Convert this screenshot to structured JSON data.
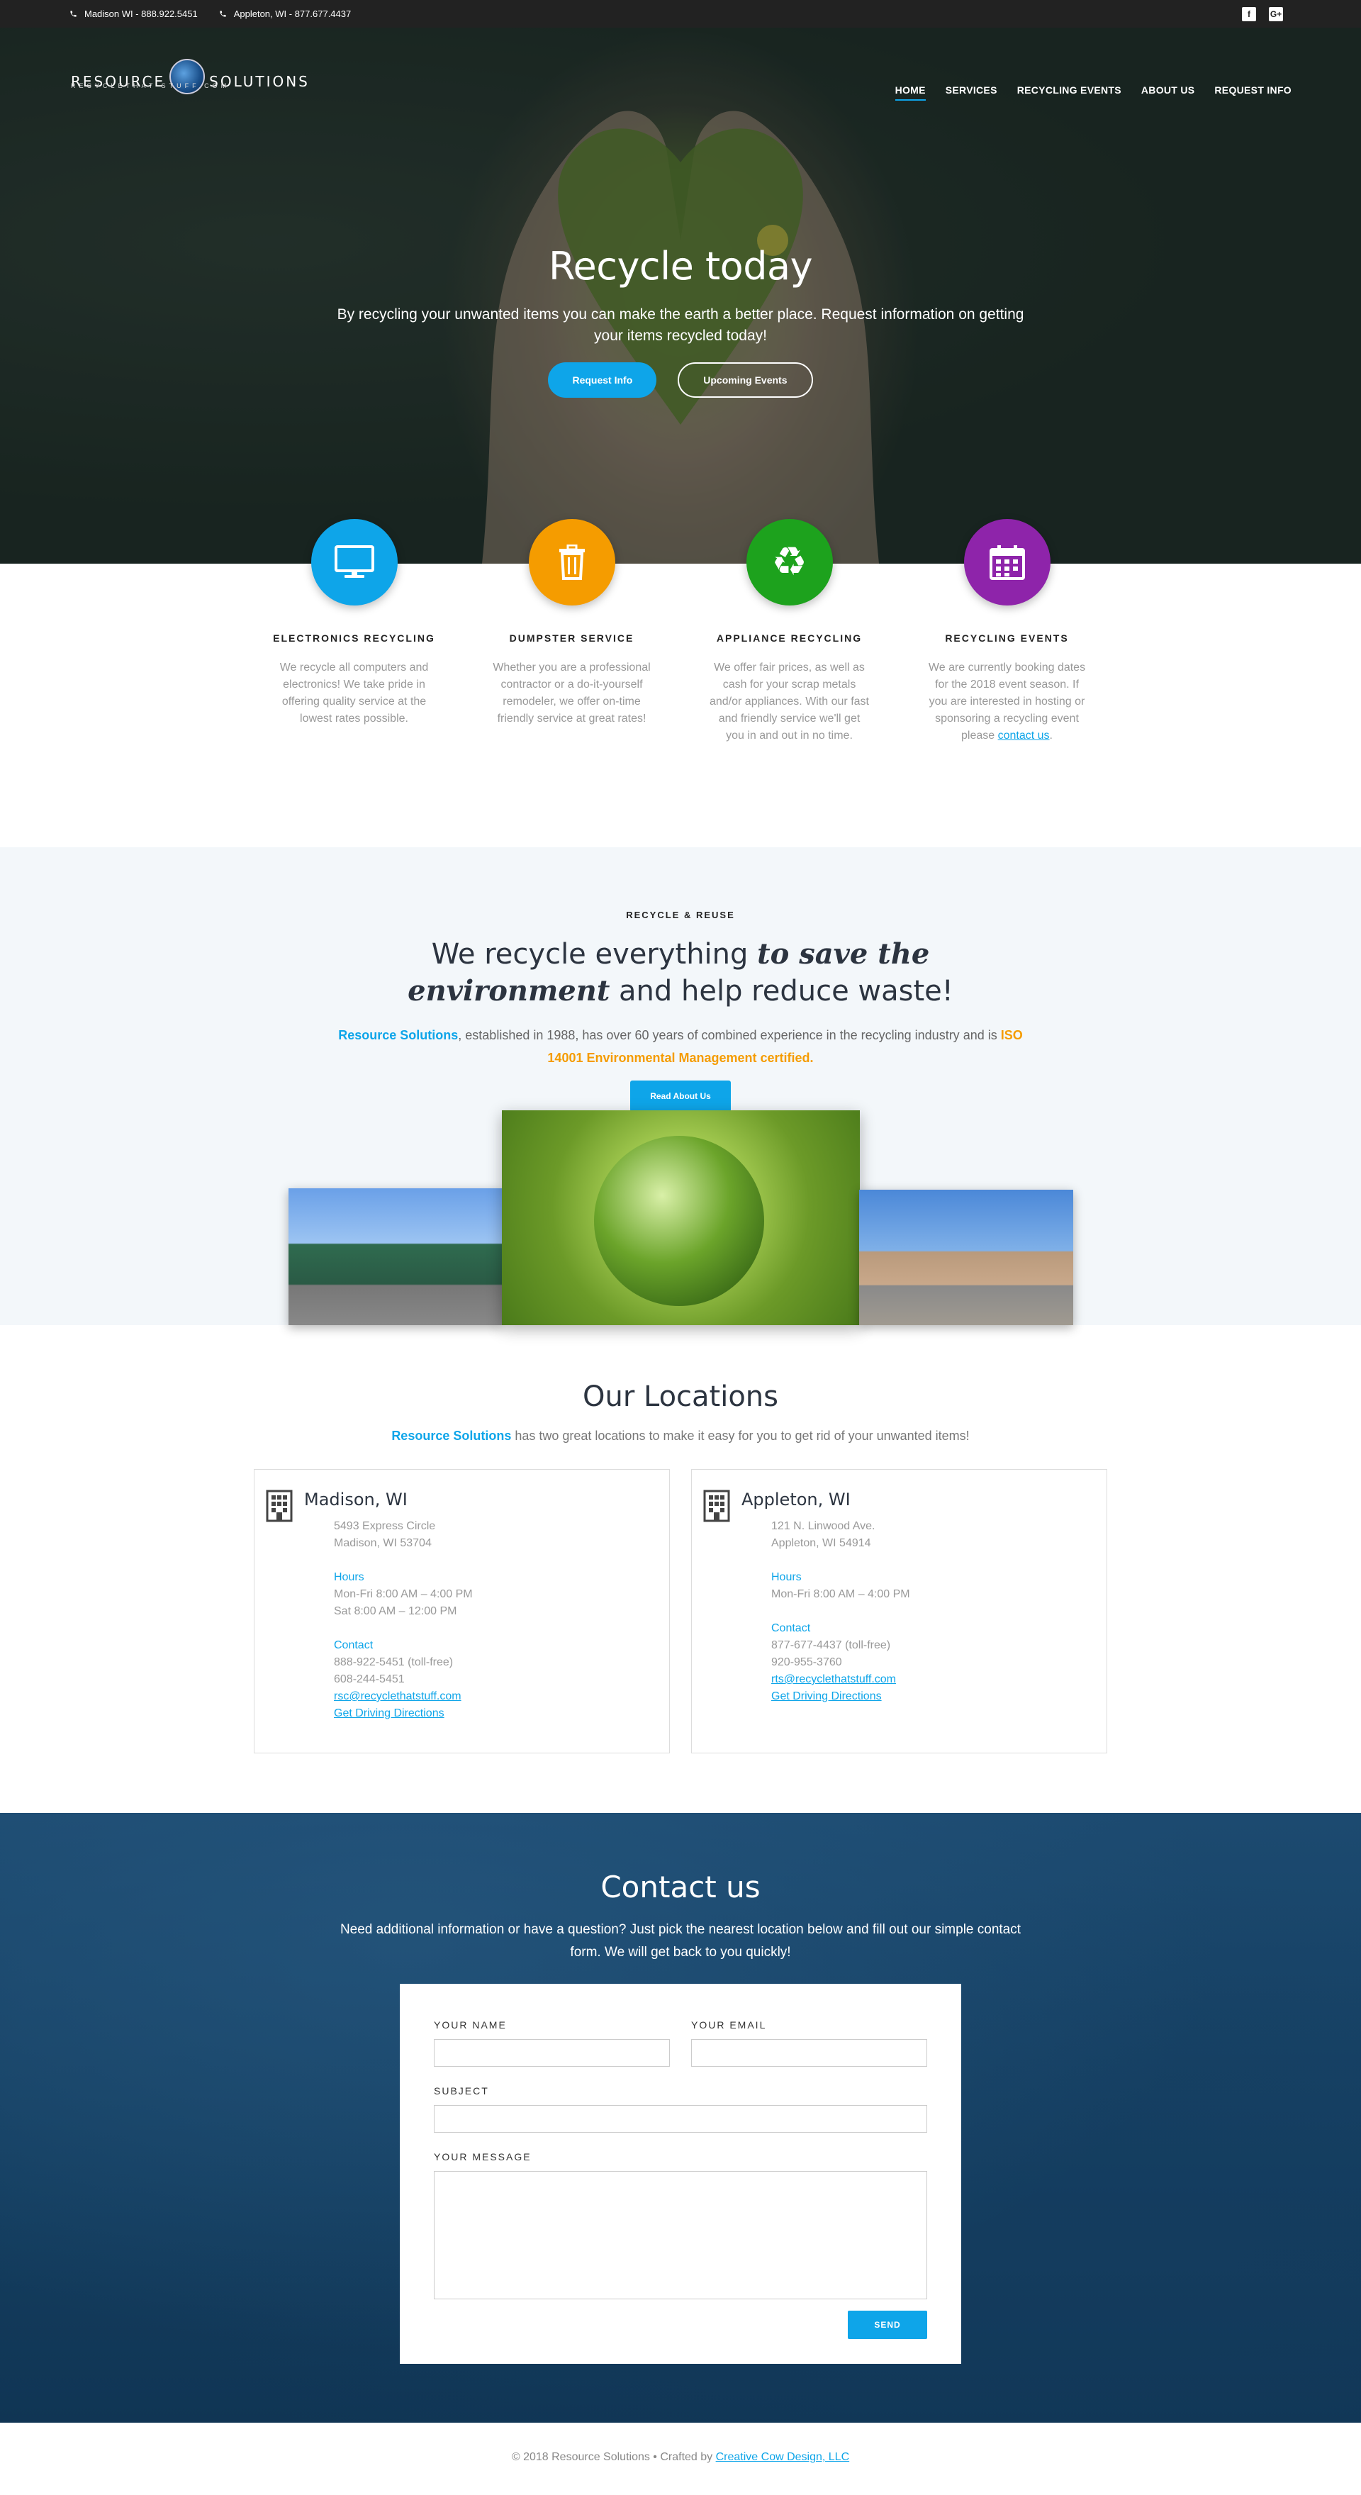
{
  "topbar": {
    "phone1": "Madison WI - 888.922.5451",
    "phone2": "Appleton, WI - 877.677.4437",
    "social": [
      {
        "icon": "facebook-icon",
        "glyph": "f"
      },
      {
        "icon": "google-plus-icon",
        "glyph": "G+"
      }
    ]
  },
  "brand": {
    "left": "RESOURCE",
    "right": "SOLUTIONS",
    "tagline": "RECYCLETHAT STUFF.COM"
  },
  "nav": [
    {
      "label": "HOME",
      "active": true
    },
    {
      "label": "SERVICES",
      "active": false
    },
    {
      "label": "RECYCLING EVENTS",
      "active": false
    },
    {
      "label": "ABOUT US",
      "active": false
    },
    {
      "label": "REQUEST INFO",
      "active": false
    }
  ],
  "hero": {
    "title": "Recycle today",
    "text": "By recycling your unwanted items you can make the earth a better place. Request information on getting your items recycled today!",
    "btn_primary": "Request Info",
    "btn_secondary": "Upcoming Events"
  },
  "services": [
    {
      "title": "ELECTRONICS RECYCLING",
      "text": "We recycle all computers and electronics! We take pride in offering quality service at the lowest rates possible.",
      "color": "#0ea5e9",
      "icon": "monitor-icon"
    },
    {
      "title": "DUMPSTER SERVICE",
      "text": "Whether you are a professional contractor or a do-it-yourself remodeler, we offer on-time friendly service at great rates!",
      "color": "#f59c00",
      "icon": "trash-icon"
    },
    {
      "title": "APPLIANCE RECYCLING",
      "text": "We offer fair prices, as well as cash for your scrap metals and/or appliances. With our fast and friendly service we'll get you in and out in no time.",
      "color": "#1da21d",
      "icon": "recycle-icon"
    },
    {
      "title": "RECYCLING EVENTS",
      "text": "We are currently booking dates for the 2018 event season. If you are interested in hosting or sponsoring a recycling event please ",
      "link": "contact us",
      "after": ".",
      "color": "#8e24aa",
      "icon": "calendar-icon"
    }
  ],
  "recycle": {
    "eyebrow": "RECYCLE & REUSE",
    "heading_pre": "We recycle everything ",
    "heading_em": "to save the environment",
    "heading_post": " and help reduce waste!",
    "lead_brand": "Resource Solutions",
    "lead_mid": ", established in 1988, has over 60 years of combined experience in the recycling industry and is ",
    "lead_cert": "ISO 14001 Environmental Management certified",
    "lead_end": ".",
    "button": "Read About Us"
  },
  "locations": {
    "title": "Our Locations",
    "lead_brand": "Resource Solutions",
    "lead_rest": " has two great locations to make it easy for you to get rid of your unwanted items!",
    "cards": [
      {
        "city": "Madison, WI",
        "address1": "5493 Express Circle",
        "address2": "Madison, WI 53704",
        "hours_label": "Hours",
        "hours1": "Mon-Fri 8:00 AM – 4:00 PM",
        "hours2": "Sat 8:00 AM – 12:00 PM",
        "contact_label": "Contact",
        "phone1": "888-922-5451 (toll-free)",
        "phone2": "608-244-5451",
        "email": "rsc@recyclethatstuff.com",
        "directions": "Get Driving Directions"
      },
      {
        "city": "Appleton, WI",
        "address1": "121 N. Linwood Ave.",
        "address2": "Appleton, WI 54914",
        "hours_label": "Hours",
        "hours1": "Mon-Fri 8:00 AM – 4:00 PM",
        "hours2": "",
        "contact_label": "Contact",
        "phone1": "877-677-4437 (toll-free)",
        "phone2": "920-955-3760",
        "email": "rts@recyclethatstuff.com",
        "directions": "Get Driving Directions"
      }
    ]
  },
  "contact": {
    "title": "Contact us",
    "lead": "Need additional information or have a question? Just pick the nearest location below and fill out our simple contact form. We will get back to you quickly!",
    "name_label": "YOUR NAME",
    "email_label": "YOUR EMAIL",
    "subject_label": "SUBJECT",
    "message_label": "YOUR MESSAGE",
    "send": "SEND"
  },
  "footer": {
    "text": "© 2018 Resource Solutions • Crafted by ",
    "link": "Creative Cow Design, LLC"
  }
}
